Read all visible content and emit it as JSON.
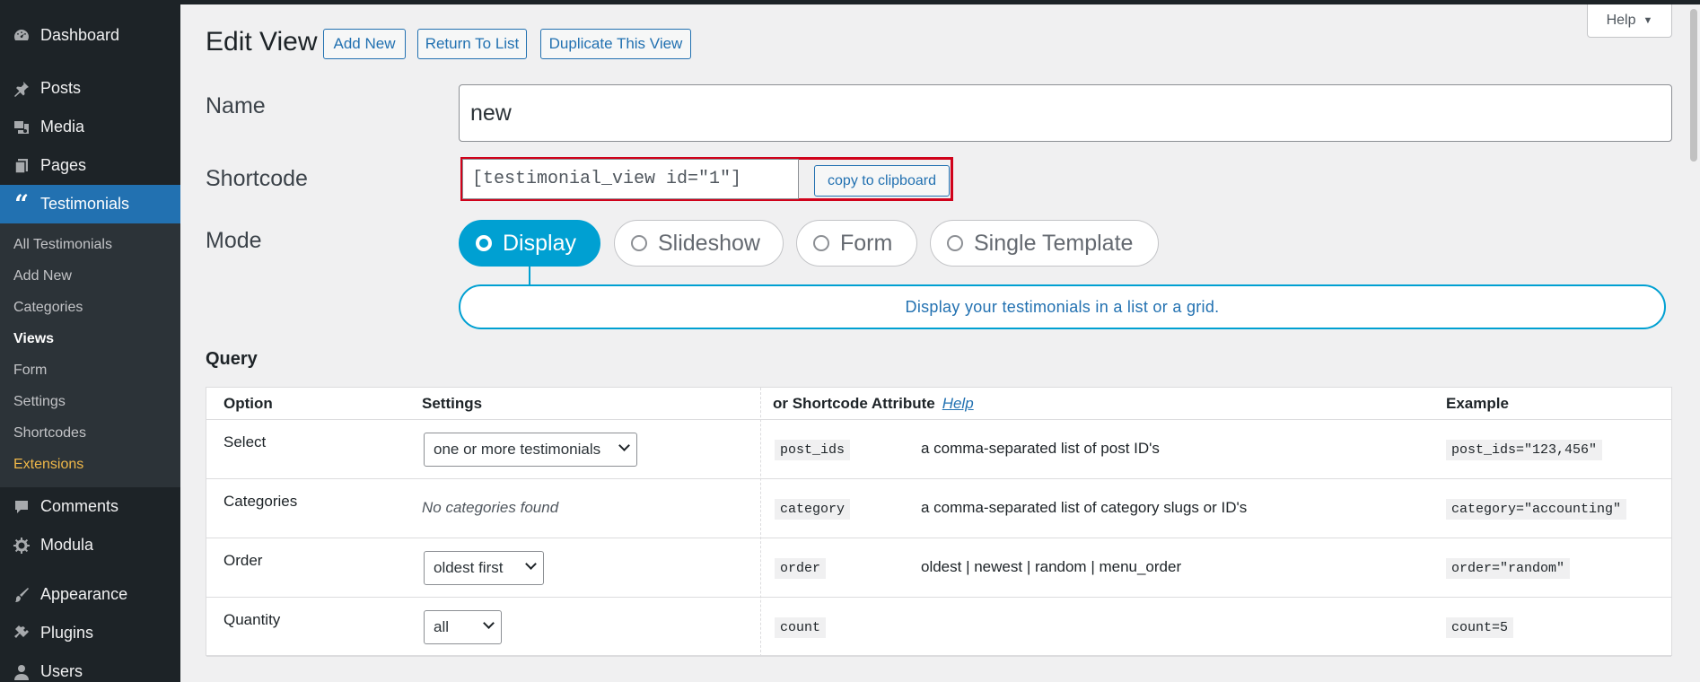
{
  "sidebar": {
    "top_items": [
      {
        "label": "Dashboard",
        "icon": "dashboard-icon"
      },
      {
        "label": "Posts",
        "icon": "pin-icon"
      },
      {
        "label": "Media",
        "icon": "media-icon"
      },
      {
        "label": "Pages",
        "icon": "pages-icon"
      },
      {
        "label": "Testimonials",
        "icon": "quote-icon"
      }
    ],
    "submenu": [
      "All Testimonials",
      "Add New",
      "Categories",
      "Views",
      "Form",
      "Settings",
      "Shortcodes",
      "Extensions"
    ],
    "bottom_items": [
      {
        "label": "Comments",
        "icon": "comment-icon"
      },
      {
        "label": "Modula",
        "icon": "gear-icon"
      },
      {
        "label": "Appearance",
        "icon": "brush-icon"
      },
      {
        "label": "Plugins",
        "icon": "plug-icon"
      },
      {
        "label": "Users",
        "icon": "user-icon"
      }
    ]
  },
  "help_tab": "Help",
  "header": {
    "title": "Edit View",
    "add_new": "Add New",
    "return_to_list": "Return To List",
    "duplicate": "Duplicate This View"
  },
  "form": {
    "name_label": "Name",
    "name_value": "new",
    "shortcode_label": "Shortcode",
    "shortcode_value": "[testimonial_view id=\"1\"]",
    "copy_button": "copy to clipboard",
    "mode_label": "Mode",
    "modes": [
      "Display",
      "Slideshow",
      "Form",
      "Single Template"
    ],
    "mode_selected": "Display",
    "mode_description": "Display your testimonials in a list or a grid."
  },
  "query": {
    "title": "Query",
    "headers": {
      "option": "Option",
      "settings": "Settings",
      "attribute": "or Shortcode Attribute",
      "help": "Help",
      "example": "Example"
    },
    "rows": [
      {
        "option": "Select",
        "setting": "one or more testimonials",
        "attr": "post_ids",
        "desc": "a comma-separated list of post ID's",
        "example": "post_ids=\"123,456\""
      },
      {
        "option": "Categories",
        "setting": "No categories found",
        "attr": "category",
        "desc": "a comma-separated list of category slugs or ID's",
        "example": "category=\"accounting\""
      },
      {
        "option": "Order",
        "setting": "oldest first",
        "attr": "order",
        "desc": "oldest | newest | random | menu_order",
        "example": "order=\"random\""
      },
      {
        "option": "Quantity",
        "setting": "all",
        "attr": "count",
        "desc": "",
        "example": "count=5"
      }
    ]
  },
  "colors": {
    "accent": "#2271b1",
    "mode_active": "#00a0d2",
    "highlight_frame": "#d0021b",
    "sidebar_bg": "#1d2327"
  }
}
